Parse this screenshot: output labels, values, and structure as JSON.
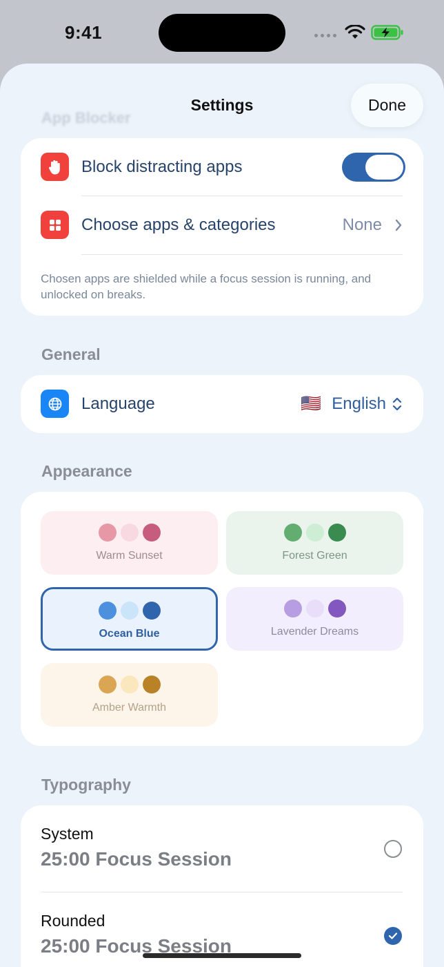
{
  "status_bar": {
    "time": "9:41"
  },
  "nav": {
    "title": "Settings",
    "done_label": "Done",
    "ghost_header": "App Blocker"
  },
  "app_blocker": {
    "block_label": "Block distracting apps",
    "block_enabled": true,
    "choose_label": "Choose apps & categories",
    "choose_value": "None",
    "footnote": "Chosen apps are shielded while a focus session is running, and unlocked on breaks."
  },
  "general": {
    "section_label": "General",
    "language_label": "Language",
    "language_flag": "🇺🇸",
    "language_value": "English"
  },
  "appearance": {
    "section_label": "Appearance",
    "selected": "Ocean Blue",
    "themes": [
      {
        "name": "Warm Sunset",
        "bg": "#fdeef2",
        "text": "#a08a8f",
        "dots": [
          "#e798a6",
          "#f9d9e1",
          "#c75d7c"
        ]
      },
      {
        "name": "Forest Green",
        "bg": "#eaf4ec",
        "text": "#7e9585",
        "dots": [
          "#63ad71",
          "#cdeed4",
          "#3a8b4f"
        ]
      },
      {
        "name": "Ocean Blue",
        "bg": "#eaf3fd",
        "text": "#2f5f9e",
        "dots": [
          "#4d90dd",
          "#cae4fa",
          "#2f65ad"
        ]
      },
      {
        "name": "Lavender Dreams",
        "bg": "#f2eefd",
        "text": "#8e8a9f",
        "dots": [
          "#b79de2",
          "#e8def9",
          "#8257bf"
        ]
      },
      {
        "name": "Amber Warmth",
        "bg": "#fdf4ea",
        "text": "#b3a288",
        "dots": [
          "#dba653",
          "#fbe7be",
          "#b98227"
        ]
      }
    ]
  },
  "typography": {
    "section_label": "Typography",
    "options": [
      {
        "name": "System",
        "sample": "25:00 Focus Session",
        "selected": false
      },
      {
        "name": "Rounded",
        "sample": "25:00 Focus Session",
        "selected": true
      }
    ]
  },
  "colors": {
    "accent": "#2f65ad",
    "icon_red": "#f0413d",
    "icon_blue": "#1a85f5"
  }
}
